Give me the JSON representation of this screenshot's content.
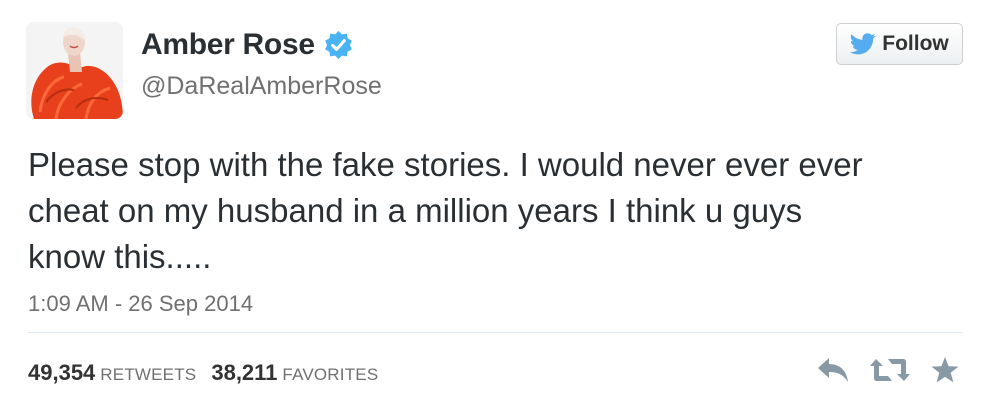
{
  "user": {
    "name": "Amber Rose",
    "handle": "@DaRealAmberRose",
    "verified": true
  },
  "follow_button": {
    "label": "Follow",
    "icon": "twitter-bird-icon"
  },
  "tweet": {
    "lines": [
      "Please stop with the fake stories. I would never ever ever",
      "cheat on my husband in a million years I think u guys",
      "know this....."
    ],
    "timestamp": "1:09 AM - 26 Sep 2014"
  },
  "stats": {
    "retweets": {
      "count": "49,354",
      "label": "RETWEETS"
    },
    "favorites": {
      "count": "38,211",
      "label": "FAVORITES"
    }
  },
  "actions": [
    "reply-icon",
    "retweet-icon",
    "favorite-icon"
  ],
  "colors": {
    "verified_blue": "#4ab3f4",
    "twitter_blue": "#55acee",
    "action_gray": "#8899a6",
    "avatar_accent": "#e8401c"
  }
}
